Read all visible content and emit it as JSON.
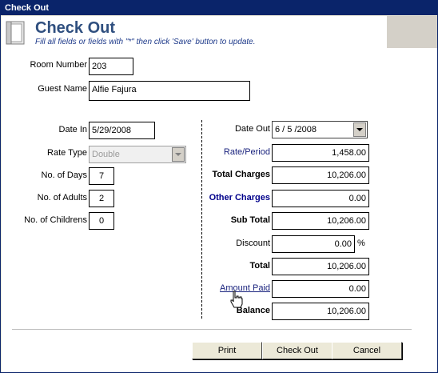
{
  "window": {
    "title": "Check Out"
  },
  "header": {
    "title": "Check Out",
    "subtitle": "Fill all fields or fields with \"*\" then click 'Save' button to update."
  },
  "guest": {
    "room_number_label": "Room Number",
    "room_number": "203",
    "guest_name_label": "Guest Name",
    "guest_name": "Alfie Fajura"
  },
  "stay": {
    "date_in_label": "Date In",
    "date_in": "5/29/2008",
    "rate_type_label": "Rate Type",
    "rate_type": "Double",
    "days_label": "No. of Days",
    "days": "7",
    "adults_label": "No. of Adults",
    "adults": "2",
    "children_label": "No. of Childrens",
    "children": "0"
  },
  "billing": {
    "date_out_label": "Date Out",
    "date_out": "6 / 5 /2008",
    "rate_period_label": "Rate/Period",
    "rate_period": "1,458.00",
    "total_charges_label": "Total Charges",
    "total_charges": "10,206.00",
    "other_charges_label": "Other Charges",
    "other_charges": "0.00",
    "sub_total_label": "Sub Total",
    "sub_total": "10,206.00",
    "discount_label": "Discount",
    "discount": "0.00",
    "discount_unit": "%",
    "total_label": "Total",
    "total": "10,206.00",
    "amount_paid_label": "Amount Paid",
    "amount_paid": "0.00",
    "balance_label": "Balance",
    "balance": "10,206.00"
  },
  "buttons": {
    "print": "Print",
    "check_out": "Check Out",
    "cancel": "Cancel"
  },
  "icons": {
    "header": "document-icon",
    "cursor": "hand-pointer-icon"
  }
}
